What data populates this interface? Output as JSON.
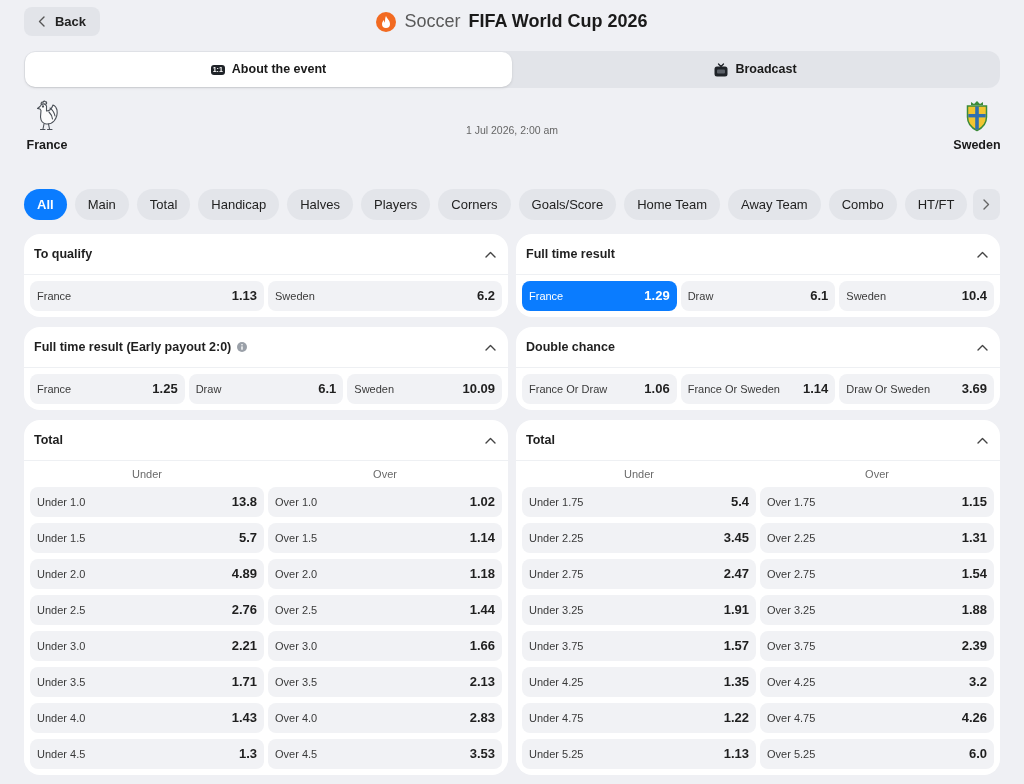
{
  "header": {
    "back_label": "Back",
    "sport": "Soccer",
    "title": "FIFA World Cup 2026"
  },
  "tabs": [
    {
      "label": "About the event",
      "badge": "1:1",
      "selected": true
    },
    {
      "label": "Broadcast",
      "selected": false
    }
  ],
  "event": {
    "home": {
      "name": "France"
    },
    "date": "1 Jul 2026, 2:00 am",
    "away": {
      "name": "Sweden"
    }
  },
  "filters": {
    "chips": [
      {
        "label": "All",
        "selected": true
      },
      {
        "label": "Main",
        "selected": false
      },
      {
        "label": "Total",
        "selected": false
      },
      {
        "label": "Handicap",
        "selected": false
      },
      {
        "label": "Halves",
        "selected": false
      },
      {
        "label": "Players",
        "selected": false
      },
      {
        "label": "Corners",
        "selected": false
      },
      {
        "label": "Goals/Score",
        "selected": false
      },
      {
        "label": "Home Team",
        "selected": false
      },
      {
        "label": "Away Team",
        "selected": false
      },
      {
        "label": "Combo",
        "selected": false
      },
      {
        "label": "HT/FT",
        "selected": false
      }
    ]
  },
  "markets": [
    {
      "kind": "outcomes",
      "title": "To qualify",
      "expanded": true,
      "outcomes": [
        {
          "label": "France",
          "odds": "1.13",
          "selected": false
        },
        {
          "label": "Sweden",
          "odds": "6.2",
          "selected": false
        }
      ]
    },
    {
      "kind": "outcomes",
      "title": "Full time result",
      "expanded": true,
      "outcomes": [
        {
          "label": "France",
          "odds": "1.29",
          "selected": true
        },
        {
          "label": "Draw",
          "odds": "6.1",
          "selected": false
        },
        {
          "label": "Sweden",
          "odds": "10.4",
          "selected": false
        }
      ]
    },
    {
      "kind": "outcomes",
      "title": "Full time result (Early payout 2:0)",
      "info": true,
      "expanded": true,
      "outcomes": [
        {
          "label": "France",
          "odds": "1.25",
          "selected": false
        },
        {
          "label": "Draw",
          "odds": "6.1",
          "selected": false
        },
        {
          "label": "Sweden",
          "odds": "10.09",
          "selected": false
        }
      ]
    },
    {
      "kind": "outcomes",
      "title": "Double chance",
      "expanded": true,
      "outcomes": [
        {
          "label": "France Or Draw",
          "odds": "1.06",
          "selected": false
        },
        {
          "label": "France Or Sweden",
          "odds": "1.14",
          "selected": false
        },
        {
          "label": "Draw Or Sweden",
          "odds": "3.69",
          "selected": false
        }
      ]
    },
    {
      "kind": "total",
      "title": "Total",
      "expanded": true,
      "columns": [
        "Under",
        "Over"
      ],
      "rows": [
        [
          {
            "label": "Under 1.0",
            "odds": "13.8",
            "selected": false
          },
          {
            "label": "Over 1.0",
            "odds": "1.02",
            "selected": false
          }
        ],
        [
          {
            "label": "Under 1.5",
            "odds": "5.7",
            "selected": false
          },
          {
            "label": "Over 1.5",
            "odds": "1.14",
            "selected": false
          }
        ],
        [
          {
            "label": "Under 2.0",
            "odds": "4.89",
            "selected": false
          },
          {
            "label": "Over 2.0",
            "odds": "1.18",
            "selected": false
          }
        ],
        [
          {
            "label": "Under 2.5",
            "odds": "2.76",
            "selected": false
          },
          {
            "label": "Over 2.5",
            "odds": "1.44",
            "selected": false
          }
        ],
        [
          {
            "label": "Under 3.0",
            "odds": "2.21",
            "selected": false
          },
          {
            "label": "Over 3.0",
            "odds": "1.66",
            "selected": false
          }
        ],
        [
          {
            "label": "Under 3.5",
            "odds": "1.71",
            "selected": false
          },
          {
            "label": "Over 3.5",
            "odds": "2.13",
            "selected": false
          }
        ],
        [
          {
            "label": "Under 4.0",
            "odds": "1.43",
            "selected": false
          },
          {
            "label": "Over 4.0",
            "odds": "2.83",
            "selected": false
          }
        ],
        [
          {
            "label": "Under 4.5",
            "odds": "1.3",
            "selected": false
          },
          {
            "label": "Over 4.5",
            "odds": "3.53",
            "selected": false
          }
        ]
      ]
    },
    {
      "kind": "total",
      "title": "Total",
      "expanded": true,
      "columns": [
        "Under",
        "Over"
      ],
      "rows": [
        [
          {
            "label": "Under 1.75",
            "odds": "5.4",
            "selected": false
          },
          {
            "label": "Over 1.75",
            "odds": "1.15",
            "selected": false
          }
        ],
        [
          {
            "label": "Under 2.25",
            "odds": "3.45",
            "selected": false
          },
          {
            "label": "Over 2.25",
            "odds": "1.31",
            "selected": false
          }
        ],
        [
          {
            "label": "Under 2.75",
            "odds": "2.47",
            "selected": false
          },
          {
            "label": "Over 2.75",
            "odds": "1.54",
            "selected": false
          }
        ],
        [
          {
            "label": "Under 3.25",
            "odds": "1.91",
            "selected": false
          },
          {
            "label": "Over 3.25",
            "odds": "1.88",
            "selected": false
          }
        ],
        [
          {
            "label": "Under 3.75",
            "odds": "1.57",
            "selected": false
          },
          {
            "label": "Over 3.75",
            "odds": "2.39",
            "selected": false
          }
        ],
        [
          {
            "label": "Under 4.25",
            "odds": "1.35",
            "selected": false
          },
          {
            "label": "Over 4.25",
            "odds": "3.2",
            "selected": false
          }
        ],
        [
          {
            "label": "Under 4.75",
            "odds": "1.22",
            "selected": false
          },
          {
            "label": "Over 4.75",
            "odds": "4.26",
            "selected": false
          }
        ],
        [
          {
            "label": "Under 5.25",
            "odds": "1.13",
            "selected": false
          },
          {
            "label": "Over 5.25",
            "odds": "6.0",
            "selected": false
          }
        ]
      ]
    }
  ]
}
